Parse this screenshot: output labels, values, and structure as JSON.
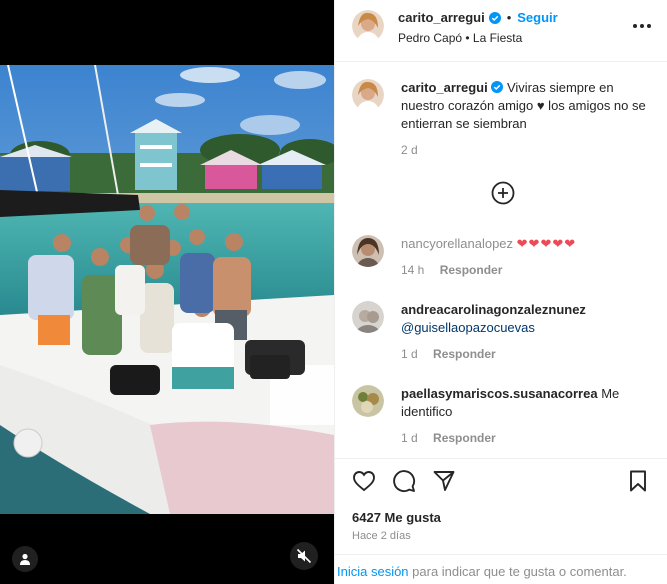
{
  "header": {
    "username": "carito_arregui",
    "separator": "•",
    "follow_label": "Seguir",
    "audio": "Pedro Capó • La Fiesta",
    "more_icon": "more-horizontal-icon"
  },
  "caption": {
    "username": "carito_arregui",
    "text": "Viviras siempre en nuestro corazón amigo ♥ los amigos no se entierran se siembran",
    "time": "2 d"
  },
  "load_more_icon": "plus-circle-icon",
  "comments": [
    {
      "username": "nancyorellanalopez",
      "text": "❤❤❤❤❤",
      "time": "14 h",
      "reply_label": "Responder"
    },
    {
      "username": "andreacarolinagonzaleznunez",
      "text": "@guisellaopazocuevas",
      "time": "1 d",
      "reply_label": "Responder"
    },
    {
      "username": "paellasymariscos.susanacorrea",
      "text": "Me identifico",
      "time": "1 d",
      "reply_label": "Responder"
    }
  ],
  "actions": {
    "like_icon": "heart-icon",
    "comment_icon": "comment-icon",
    "share_icon": "send-icon",
    "save_icon": "bookmark-icon"
  },
  "likes": "6427 Me gusta",
  "posted": "Hace 2 días",
  "login": {
    "link": "Inicia sesión",
    "text": " para indicar que te gusta o comentar."
  },
  "colors": {
    "accent": "#0095f6",
    "text": "#262626",
    "muted": "#8e8e8e",
    "heart": "#ed4956",
    "media_bg": "#000000"
  }
}
